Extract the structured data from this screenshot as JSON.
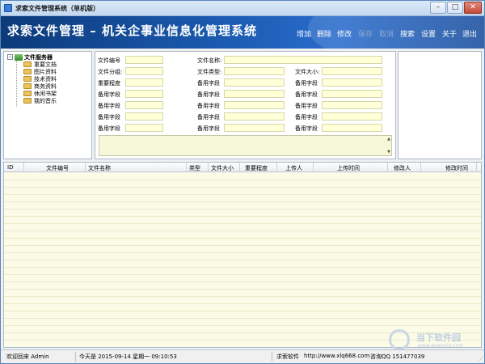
{
  "window": {
    "title": "求索文件管理系统（单机版）",
    "controls": {
      "minimize": "–",
      "maximize": "□",
      "close": "✕"
    }
  },
  "banner": {
    "title": "求索文件管理 – 机关企事业信息化管理系统"
  },
  "menu": [
    {
      "label": "增加",
      "enabled": true
    },
    {
      "label": "删除",
      "enabled": true
    },
    {
      "label": "修改",
      "enabled": true
    },
    {
      "label": "保存",
      "enabled": false
    },
    {
      "label": "取消",
      "enabled": false
    },
    {
      "label": "搜索",
      "enabled": true
    },
    {
      "label": "设置",
      "enabled": true
    },
    {
      "label": "关于",
      "enabled": true
    },
    {
      "label": "退出",
      "enabled": true
    }
  ],
  "tree": {
    "root": {
      "label": "文件服务器",
      "expander": "−"
    },
    "items": [
      "重要文档",
      "图片资料",
      "技术资料",
      "商务资料",
      "休闲书架",
      "我的音乐"
    ]
  },
  "form": {
    "col1": [
      "文件编号",
      "文件分组:",
      "重要程度",
      "备用字段",
      "备用字段",
      "备用字段",
      "备用字段"
    ],
    "col2": [
      "文件名称:",
      "文件类型:",
      "备用字段",
      "备用字段",
      "备用字段",
      "备用字段",
      "备用字段"
    ],
    "col3": [
      "文件大小:",
      "备用字段",
      "备用字段",
      "备用字段",
      "备用字段",
      "备用字段"
    ],
    "memo_scroll": {
      "up": "▲",
      "down": "▼"
    }
  },
  "grid": {
    "columns": [
      "ID",
      "文件编号",
      "文件名称",
      "类型",
      "文件大小",
      "重要程度",
      "上传人",
      "上传时间",
      "修改人",
      "修改时间"
    ],
    "rows": []
  },
  "status": {
    "welcome": "欢迎回来 Admin",
    "datetime": "今天是 2015-09-14 星期一 09:10:53",
    "vendor": "求索软件",
    "website": "http://www.xlq668.com",
    "qq": "咨询QQ 151477039",
    "grip": "⋰"
  },
  "watermark": {
    "line1": "当下软件园",
    "line2": "www.downxia.com"
  }
}
